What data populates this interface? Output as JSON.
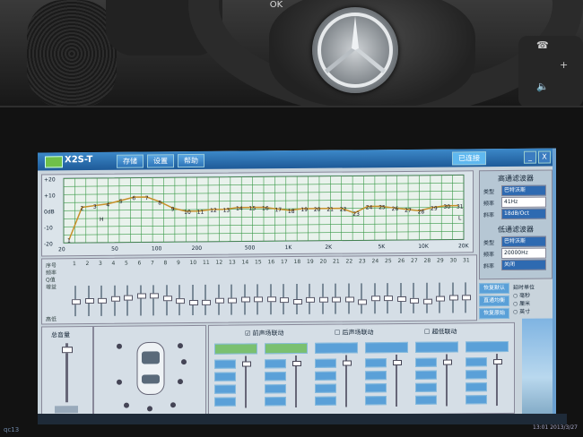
{
  "watermark": "qc13",
  "steering": {
    "ok_label": "OK"
  },
  "app": {
    "title": "X2S-T",
    "menu": [
      "存储",
      "设置",
      "帮助"
    ],
    "connect_label": "已连接",
    "window_controls": [
      "_",
      "X"
    ]
  },
  "graph": {
    "y_labels": [
      "+20",
      "+10",
      "0dB",
      "-10",
      "-20"
    ],
    "x_labels": [
      "20",
      "50",
      "100",
      "200",
      "500",
      "1K",
      "2K",
      "5K",
      "10K",
      "20K"
    ],
    "marker_labels": [
      "1",
      "2",
      "3",
      "4",
      "5",
      "6",
      "7",
      "8",
      "9",
      "10",
      "11",
      "12",
      "13",
      "14",
      "15",
      "16",
      "17",
      "18",
      "19",
      "20",
      "21",
      "22",
      "23",
      "24",
      "25",
      "26",
      "27",
      "28",
      "29",
      "30",
      "31"
    ],
    "curve_points_db": [
      -18,
      2,
      3,
      4,
      6,
      8,
      8,
      5,
      1,
      -1,
      -1,
      0,
      0,
      1,
      1,
      1,
      0,
      -1,
      0,
      0,
      0,
      0,
      -3,
      1,
      1,
      0,
      -1,
      -2,
      0,
      1,
      1
    ],
    "extra_labels": [
      "H",
      "L"
    ]
  },
  "high_pass": {
    "title": "高通滤波器",
    "rows": [
      {
        "label": "类型",
        "value": "巴特沃斯"
      },
      {
        "label": "频率",
        "value": "41Hz"
      },
      {
        "label": "斜率",
        "value": "18dB/Oct"
      }
    ]
  },
  "low_pass": {
    "title": "低通滤波器",
    "rows": [
      {
        "label": "类型",
        "value": "巴特沃斯"
      },
      {
        "label": "频率",
        "value": "20000Hz"
      },
      {
        "label": "斜率",
        "value": "关闭"
      }
    ]
  },
  "bands": {
    "row_labels": [
      "序号",
      "频率",
      "Q值",
      "增益",
      "高低"
    ],
    "numbers": [
      "1",
      "2",
      "3",
      "4",
      "5",
      "6",
      "7",
      "8",
      "9",
      "10",
      "11",
      "12",
      "13",
      "14",
      "15",
      "16",
      "17",
      "18",
      "19",
      "20",
      "21",
      "22",
      "23",
      "24",
      "25",
      "26",
      "27",
      "28",
      "29",
      "30",
      "31"
    ],
    "slider_levels": [
      0.5,
      0.55,
      0.55,
      0.6,
      0.65,
      0.7,
      0.7,
      0.6,
      0.5,
      0.45,
      0.45,
      0.5,
      0.5,
      0.55,
      0.55,
      0.55,
      0.5,
      0.45,
      0.5,
      0.5,
      0.5,
      0.5,
      0.4,
      0.55,
      0.55,
      0.5,
      0.45,
      0.4,
      0.5,
      0.55,
      0.55
    ],
    "side_buttons": [
      "恢复默认",
      "直通均衡",
      "恢复原始"
    ],
    "unit_title": "延时单位",
    "unit_options": [
      "毫秒",
      "厘米",
      "英寸"
    ]
  },
  "bottom": {
    "volume_title": "总音量",
    "channel_flags": [
      "前声场联动",
      "后声场联动",
      "超低联动"
    ]
  },
  "clock": {
    "time": "13:01",
    "date": "2013/3/27"
  }
}
